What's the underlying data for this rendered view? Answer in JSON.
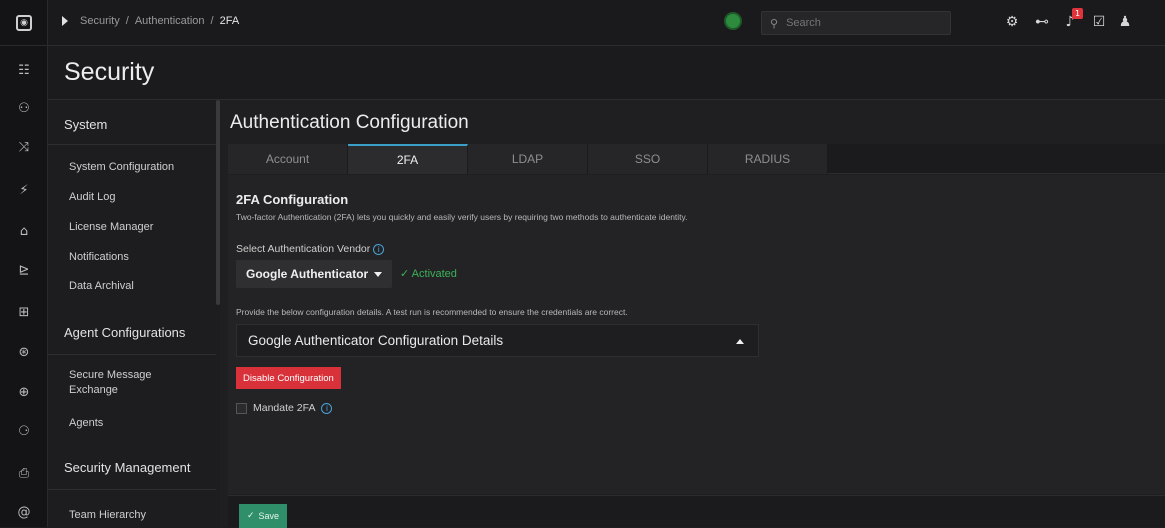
{
  "topbar": {
    "breadcrumb": [
      "Security",
      "Authentication",
      "2FA"
    ],
    "search_placeholder": "Search",
    "notification_count": "1"
  },
  "icons": {
    "rail": [
      "dashboard-icon",
      "users-icon",
      "shuffle-icon",
      "bolt-icon",
      "bank-icon",
      "chart-icon",
      "grid-icon",
      "steering-icon",
      "globe-icon",
      "team-icon",
      "clipboard-icon",
      "at-icon"
    ],
    "top": [
      "settings-icon",
      "tree-icon",
      "bell-icon",
      "checklist-icon",
      "user-icon"
    ]
  },
  "page": {
    "title": "Security"
  },
  "sidebar": {
    "groups": [
      {
        "title": "System",
        "items": [
          "System Configuration",
          "Audit Log",
          "License Manager",
          "Notifications",
          "Data Archival"
        ]
      },
      {
        "title": "Agent Configurations",
        "items": [
          "Secure Message Exchange",
          "Agents"
        ]
      },
      {
        "title": "Security Management",
        "items": [
          "Team Hierarchy"
        ]
      }
    ]
  },
  "main": {
    "title": "Authentication Configuration",
    "tabs": [
      "Account",
      "2FA",
      "LDAP",
      "SSO",
      "RADIUS"
    ],
    "active_tab": "2FA",
    "section_title": "2FA Configuration",
    "description": "Two-factor Authentication (2FA) lets you quickly and easily verify users by requiring two methods to authenticate identity.",
    "vendor_label": "Select Authentication Vendor",
    "vendor_value": "Google Authenticator",
    "vendor_status": "Activated",
    "config_note": "Provide the below configuration details. A test run is recommended to ensure the credentials are correct.",
    "panel_title": "Google Authenticator Configuration Details",
    "disable_button": "Disable Configuration",
    "mandate_label": "Mandate 2FA",
    "save_button": "Save"
  },
  "colors": {
    "accent_blue": "#3aa0c8",
    "danger": "#d9313a",
    "success": "#3cb058",
    "save": "#2f8f6a"
  }
}
